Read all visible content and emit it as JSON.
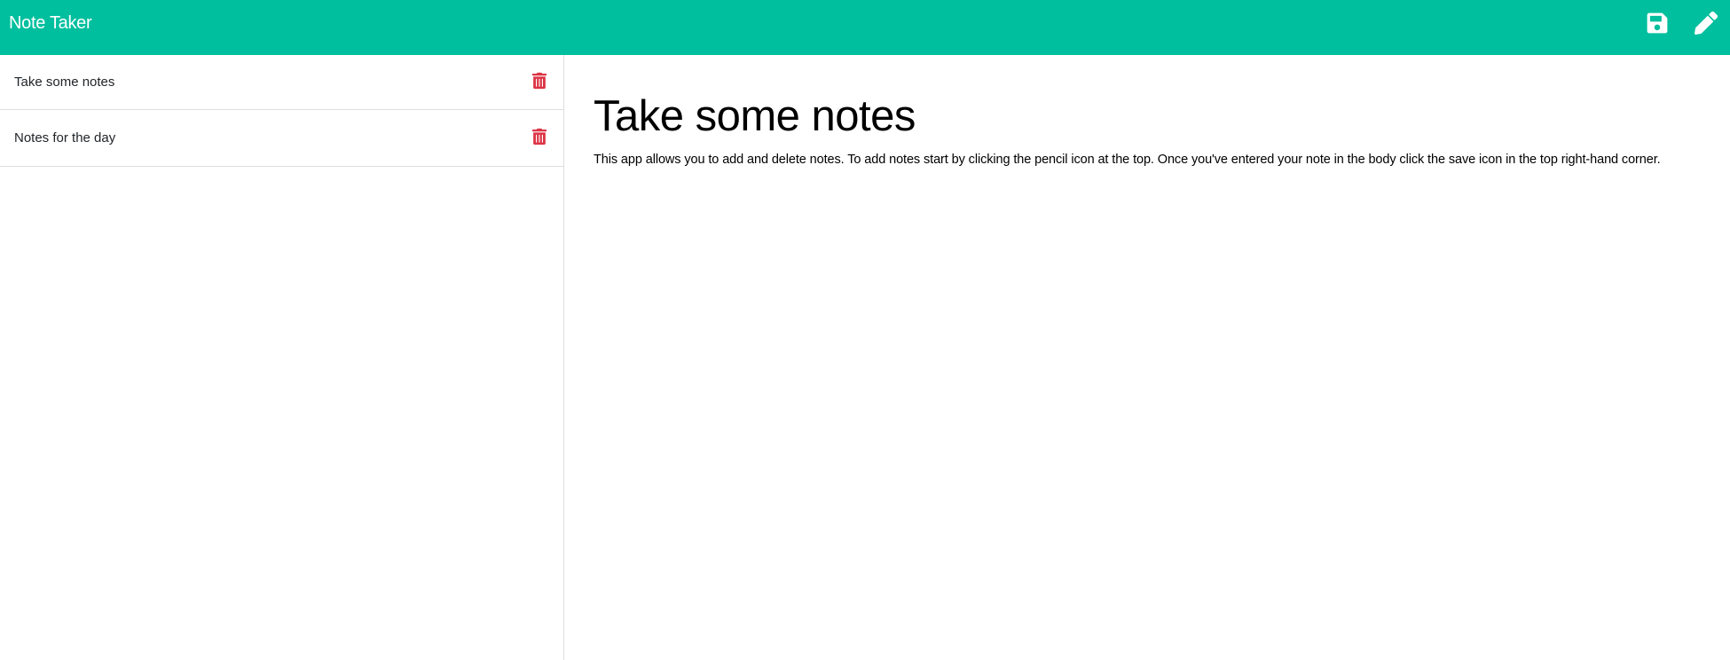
{
  "header": {
    "title": "Note Taker",
    "save_icon": "save-icon",
    "new_note_icon": "pencil-icon",
    "background_color": "#00bf9e"
  },
  "sidebar": {
    "notes": [
      {
        "title": "Take some notes",
        "delete_icon": "trash-icon"
      },
      {
        "title": "Notes for the day",
        "delete_icon": "trash-icon"
      }
    ],
    "delete_icon_color": "#dc3545"
  },
  "main": {
    "title": "Take some notes",
    "body": "This app allows you to add and delete notes. To add notes start by clicking the pencil icon at the top. Once you've entered your note in the body click the save icon in the top right-hand corner."
  }
}
